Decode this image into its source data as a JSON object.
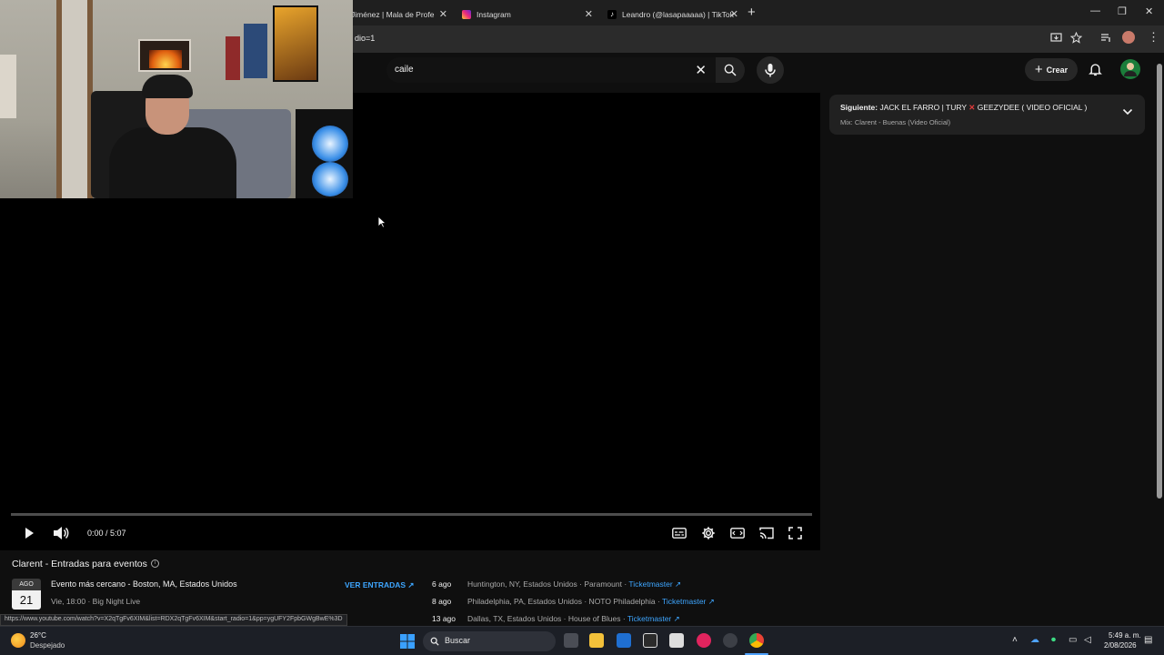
{
  "browser": {
    "tabs": [
      {
        "title": "Jiménez | Mala de Profe",
        "favicon_color": "#c4302b"
      },
      {
        "title": "Instagram",
        "favicon_color": "#d6249f"
      },
      {
        "title": "Leandro (@lasapaaaaa) | TikTok",
        "favicon_color": "#111111"
      }
    ],
    "tab_close": "✕",
    "new_tab": "+",
    "url_fragment": "dio=1",
    "window_controls": {
      "minimize": "—",
      "maximize": "❐",
      "close": "✕"
    }
  },
  "header": {
    "search_value": "caile",
    "clear_icon": "✕",
    "create_label": "Crear"
  },
  "player": {
    "time": "0:00 / 5:07",
    "progress": 0
  },
  "up_next": {
    "prefix": "Siguiente:",
    "title_part1": "JACK EL FARRO | TURY",
    "title_part2": "GEEZYDEE ( VIDEO OFICIAL )",
    "subtitle": "Mix: Clarent - Buenas (Video Oficial)"
  },
  "events": {
    "title": "Clarent - Entradas para eventos",
    "info_icon": "i",
    "date_month": "AGO",
    "date_day": "21",
    "nearest": "Evento más cercano - Boston, MA, Estados Unidos",
    "nearest_time": "Vie, 18:00 · Big Night Live",
    "tickets_button": "VER ENTRADAS ↗",
    "rows": [
      {
        "date": "6 ago",
        "place": "Huntington, NY, Estados Unidos · Paramount",
        "sep": " · ",
        "vendor": "Ticketmaster ↗"
      },
      {
        "date": "8 ago",
        "place": "Philadelphia, PA, Estados Unidos · NOTO Philadelphia",
        "sep": " · ",
        "vendor": "Ticketmaster ↗"
      },
      {
        "date": "13 ago",
        "place": "Dallas, TX, Estados Unidos · House of Blues",
        "sep": " · ",
        "vendor": "Ticketmaster ↗"
      }
    ]
  },
  "status_link": "https://www.youtube.com/watch?v=X2qTgFv6XIM&list=RDX2qTgFv6XIM&start_radio=1&pp=ygUFY2FpbGWgBwE%3D",
  "taskbar": {
    "weather_temp": "26°C",
    "weather_desc": "Despejado",
    "search_label": "Buscar",
    "time": "5:49 a. m.",
    "date": "2/08/2026"
  }
}
